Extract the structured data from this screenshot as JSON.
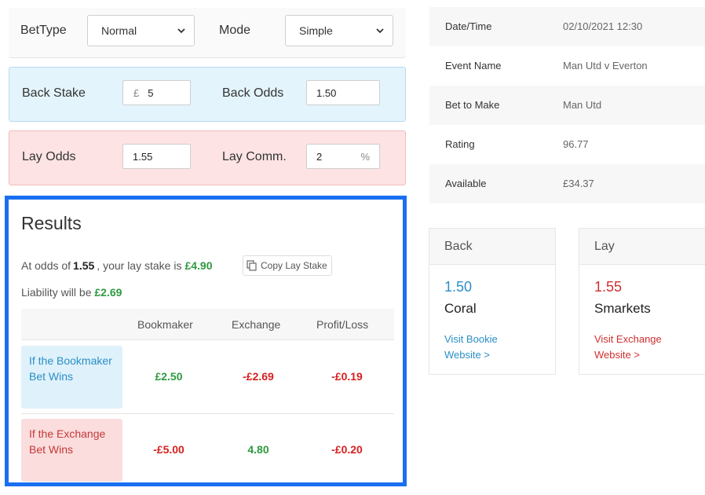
{
  "calculator": {
    "bet_type_label": "BetType",
    "bet_type_value": "Normal",
    "mode_label": "Mode",
    "mode_value": "Simple",
    "back_stake_label": "Back Stake",
    "back_stake_prefix": "£",
    "back_stake_value": "5",
    "back_odds_label": "Back Odds",
    "back_odds_value": "1.50",
    "lay_odds_label": "Lay Odds",
    "lay_odds_value": "1.55",
    "lay_comm_label": "Lay Comm.",
    "lay_comm_value": "2",
    "lay_comm_suffix": "%"
  },
  "results": {
    "title": "Results",
    "summary_prefix": "At odds of",
    "odds": "1.55",
    "summary_middle": ", your lay stake is",
    "lay_stake": "£4.90",
    "copy_button_label": "Copy Lay Stake",
    "liability_prefix": "Liability will be",
    "liability": "£2.69",
    "columns": [
      "Bookmaker",
      "Exchange",
      "Profit/Loss"
    ],
    "rows": [
      {
        "label": "If the Bookmaker Bet Wins",
        "bookmaker": "£2.50",
        "exchange": "-£2.69",
        "profit_loss": "-£0.19"
      },
      {
        "label": "If the Exchange Bet Wins",
        "bookmaker": "-£5.00",
        "exchange": "4.80",
        "profit_loss": "-£0.20"
      }
    ]
  },
  "details": [
    {
      "key": "Date/Time",
      "value": "02/10/2021 12:30"
    },
    {
      "key": "Event Name",
      "value": "Man Utd v Everton"
    },
    {
      "key": "Bet to Make",
      "value": "Man Utd"
    },
    {
      "key": "Rating",
      "value": "96.77"
    },
    {
      "key": "Available",
      "value": "£34.37"
    }
  ],
  "back_card": {
    "header": "Back",
    "odds": "1.50",
    "name": "Coral",
    "link_line1": "Visit Bookie",
    "link_line2": "Website >"
  },
  "lay_card": {
    "header": "Lay",
    "odds": "1.55",
    "name": "Smarkets",
    "link_line1": "Visit Exchange",
    "link_line2": "Website >"
  },
  "colors": {
    "results_border": "#1a6ff0",
    "positive": "#2e9a3e",
    "negative": "#d81f1f",
    "back_accent": "#2a8fc6",
    "lay_accent": "#d03030"
  }
}
